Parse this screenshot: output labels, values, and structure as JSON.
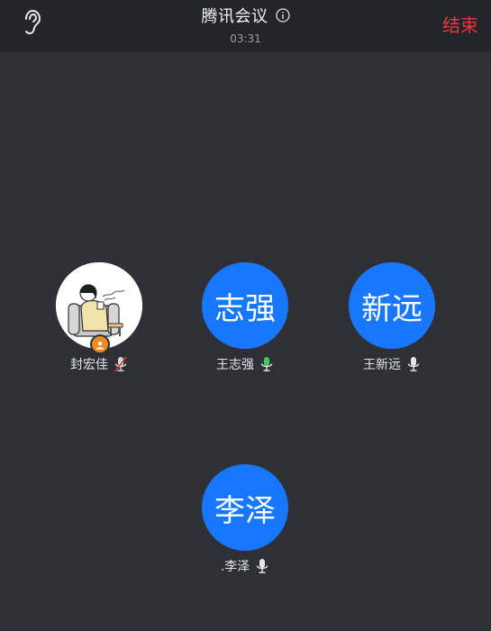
{
  "header": {
    "title": "腾讯会议",
    "timer": "03:31",
    "end_label": "结束",
    "ear_icon": "ear-icon",
    "info_icon": "info-icon"
  },
  "participants": [
    {
      "avatar_text": "",
      "name": "封宏佳",
      "mic_status": "muted",
      "is_host": true,
      "avatar_type": "photo"
    },
    {
      "avatar_text": "志强",
      "name": "王志强",
      "mic_status": "speaking",
      "avatar_type": "initials"
    },
    {
      "avatar_text": "新远",
      "name": "王新远",
      "mic_status": "on",
      "avatar_type": "initials"
    },
    {
      "avatar_text": "李泽",
      "name": ".李泽",
      "mic_status": "on",
      "avatar_type": "initials"
    }
  ],
  "colors": {
    "background": "#2e3035",
    "topbar": "#23252a",
    "avatar_blue": "#1777ff",
    "end_red": "#e8383d",
    "mic_speaking_green": "#3ecb5c",
    "mic_muted_red": "#e8383d",
    "host_badge_orange": "#f08a24"
  }
}
